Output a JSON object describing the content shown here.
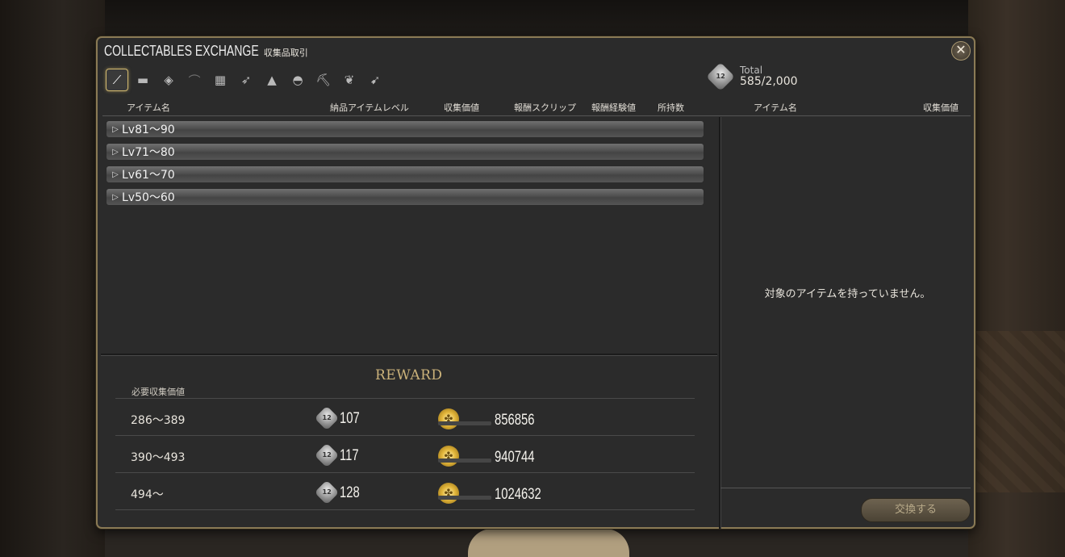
{
  "window": {
    "title": "COLLECTABLES EXCHANGE",
    "subtitle": "収集品取引",
    "close_icon": "close-x-icon"
  },
  "tabs": [
    {
      "name": "carpenter",
      "icon": "saw-icon",
      "glyph": "⟋",
      "active": true
    },
    {
      "name": "blacksmith",
      "icon": "anvil-icon",
      "glyph": "▬",
      "active": false
    },
    {
      "name": "armorer",
      "icon": "helmet-icon",
      "glyph": "◈",
      "active": false
    },
    {
      "name": "goldsmith",
      "icon": "crown-icon",
      "glyph": "⌒",
      "active": false
    },
    {
      "name": "leatherworker",
      "icon": "hide-icon",
      "glyph": "▦",
      "active": false
    },
    {
      "name": "weaver",
      "icon": "needle-icon",
      "glyph": "➶",
      "active": false
    },
    {
      "name": "alchemist",
      "icon": "flask-icon",
      "glyph": "▲",
      "active": false
    },
    {
      "name": "culinarian",
      "icon": "bread-icon",
      "glyph": "◓",
      "active": false
    },
    {
      "name": "miner",
      "icon": "pickaxe-icon",
      "glyph": "⛏",
      "active": false
    },
    {
      "name": "botanist",
      "icon": "sickle-icon",
      "glyph": "❦",
      "active": false
    },
    {
      "name": "fisher",
      "icon": "fish-icon",
      "glyph": "➹",
      "active": false
    }
  ],
  "total": {
    "label": "Total",
    "value": "585/2,000",
    "icon": "scrip-icon",
    "icon_text": "12"
  },
  "headers": {
    "item_name": "アイテム名",
    "item_level": "納品アイテムレベル",
    "collectability": "収集価値",
    "reward_scrip": "報酬スクリップ",
    "reward_exp": "報酬経験値",
    "owned": "所持数",
    "right_item_name": "アイテム名",
    "right_collectability": "収集価値"
  },
  "categories": [
    {
      "label": "Lv81～90"
    },
    {
      "label": "Lv71～80"
    },
    {
      "label": "Lv61～70"
    },
    {
      "label": "Lv50～60"
    }
  ],
  "right_pane": {
    "empty_message": "対象のアイテムを持っていません。"
  },
  "reward": {
    "title": "REWARD",
    "required_label": "必要収集価値",
    "rows": [
      {
        "range": "286～389",
        "scrip": "107",
        "exp": "856856"
      },
      {
        "range": "390～493",
        "scrip": "117",
        "exp": "940744"
      },
      {
        "range": "494～",
        "scrip": "128",
        "exp": "1024632"
      }
    ]
  },
  "exchange_button": "交換する",
  "colors": {
    "accent_gold": "#cbb27a",
    "window_bg": "#2b2b2b",
    "border_gold": "#8a7a55"
  }
}
